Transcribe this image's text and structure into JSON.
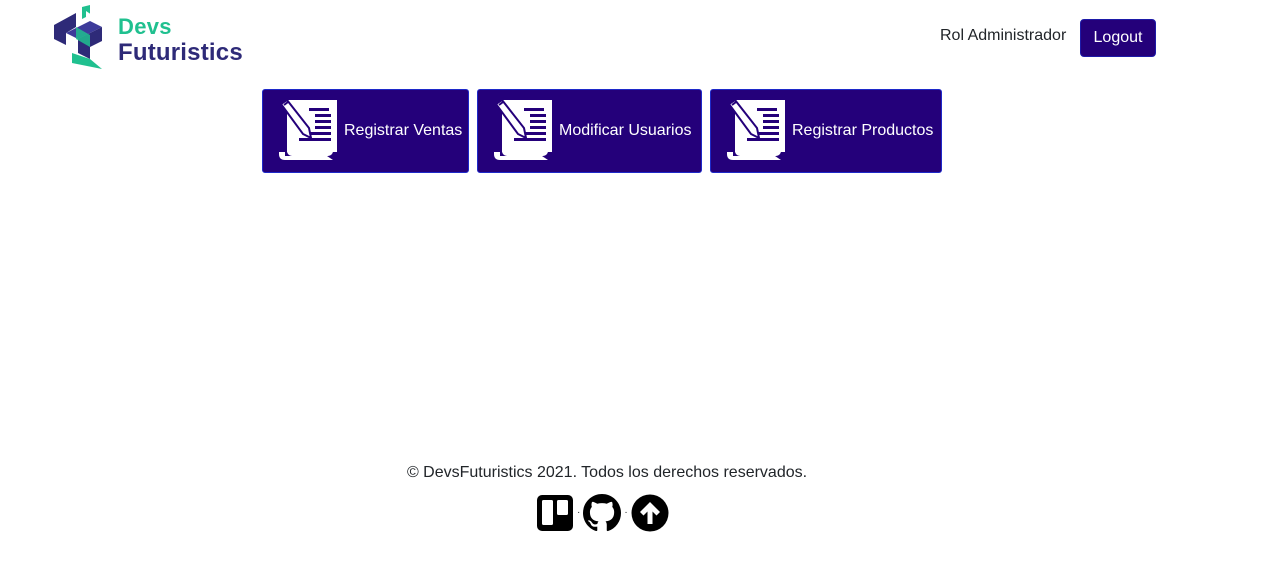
{
  "header": {
    "logo": {
      "line1": "Devs",
      "line2": "Futuristics",
      "icon": "devs-futuristics-logo"
    },
    "role_text": "Rol Administrador",
    "logout_label": "Logout"
  },
  "actions": [
    {
      "label": "Registrar Ventas",
      "icon": "document-pen-icon"
    },
    {
      "label": "Modificar Usuarios",
      "icon": "document-pen-icon"
    },
    {
      "label": "Registrar Productos",
      "icon": "document-pen-icon"
    }
  ],
  "footer": {
    "copyright": "© DevsFuturistics 2021. Todos los derechos reservados.",
    "separator": "·",
    "links": [
      {
        "icon": "trello-icon"
      },
      {
        "icon": "github-icon"
      },
      {
        "icon": "arrow-up-circle-icon"
      }
    ]
  },
  "colors": {
    "primary": "#24007a",
    "logo_green": "#20c08f",
    "logo_navy": "#2e2a78",
    "text": "#212529"
  }
}
